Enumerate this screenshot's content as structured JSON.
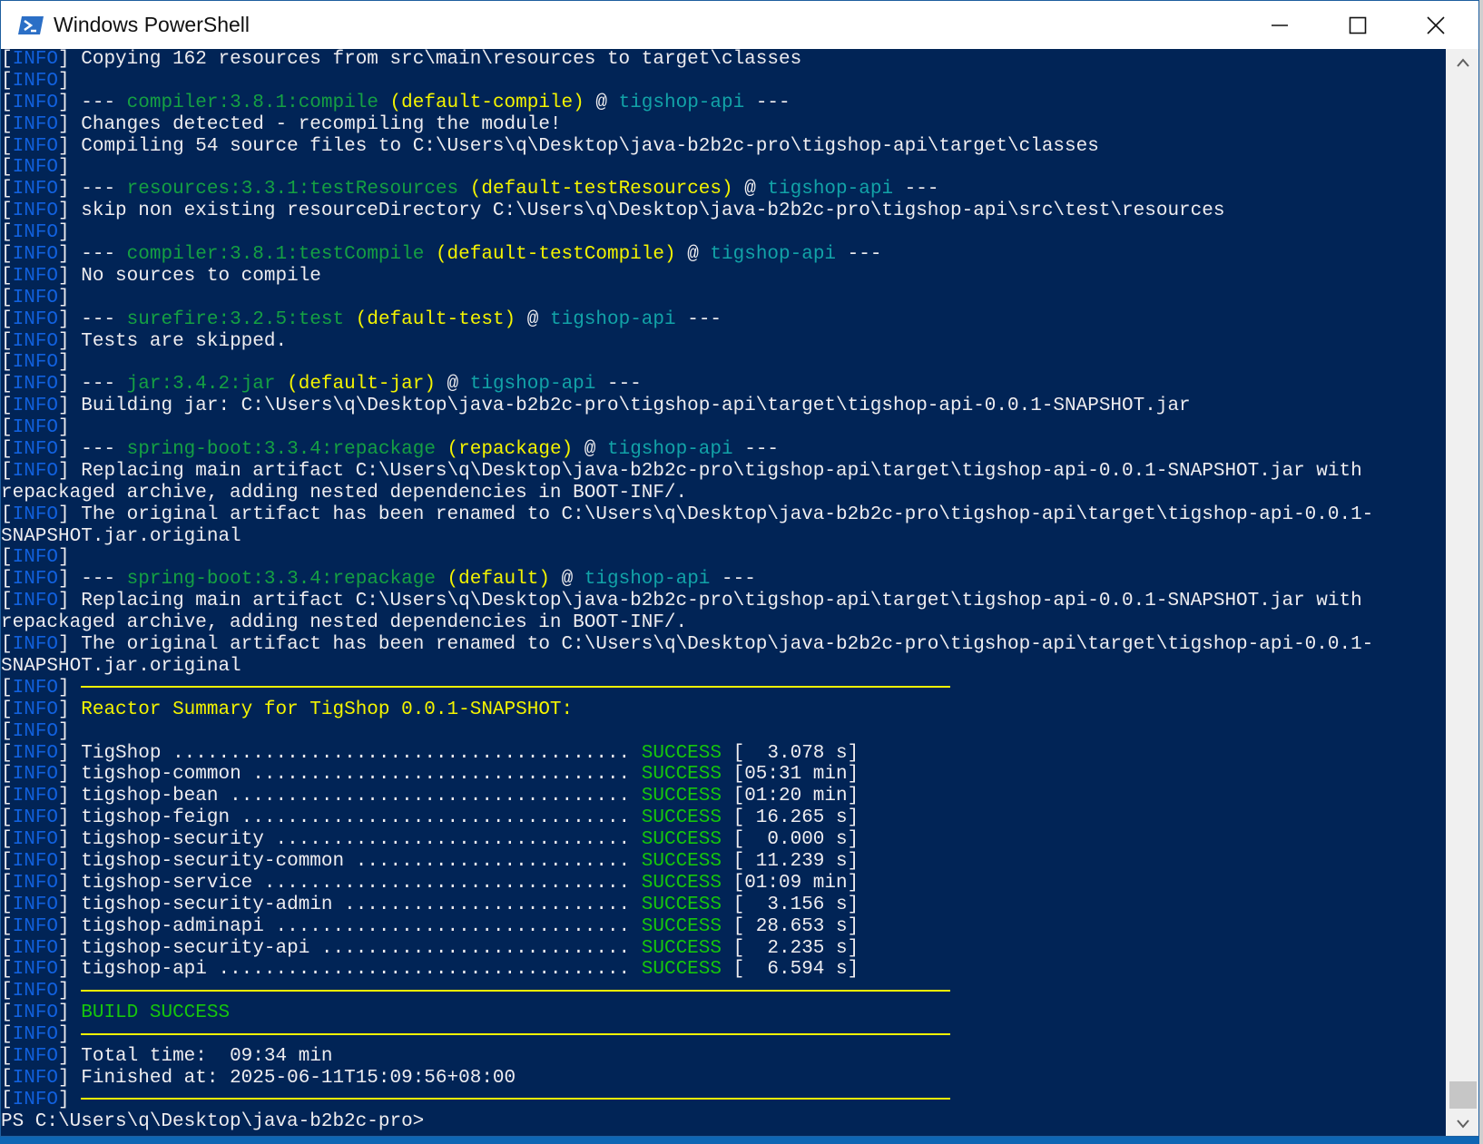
{
  "window": {
    "title": "Windows PowerShell",
    "icon": "powershell-icon",
    "controls": [
      "minimize-icon",
      "maximize-icon",
      "close-icon"
    ]
  },
  "colors": {
    "console_bg": "#012456",
    "info": "#1160dd",
    "plugin": "#15a043",
    "execution": "#f4f400",
    "project": "#12a3a8",
    "success": "#16c60c"
  },
  "lines": [
    {
      "type": "text",
      "text": "Copying 162 resources from src\\main\\resources to target\\classes"
    },
    {
      "type": "empty"
    },
    {
      "type": "mojo",
      "plugin": "compiler:3.8.1:compile",
      "exec": "(default-compile)",
      "project": "tigshop-api"
    },
    {
      "type": "text",
      "text": "Changes detected - recompiling the module!"
    },
    {
      "type": "text",
      "text": "Compiling 54 source files to C:\\Users\\q\\Desktop\\java-b2b2c-pro\\tigshop-api\\target\\classes"
    },
    {
      "type": "empty"
    },
    {
      "type": "mojo",
      "plugin": "resources:3.3.1:testResources",
      "exec": "(default-testResources)",
      "project": "tigshop-api"
    },
    {
      "type": "text",
      "text": "skip non existing resourceDirectory C:\\Users\\q\\Desktop\\java-b2b2c-pro\\tigshop-api\\src\\test\\resources"
    },
    {
      "type": "empty"
    },
    {
      "type": "mojo",
      "plugin": "compiler:3.8.1:testCompile",
      "exec": "(default-testCompile)",
      "project": "tigshop-api"
    },
    {
      "type": "text",
      "text": "No sources to compile"
    },
    {
      "type": "empty"
    },
    {
      "type": "mojo",
      "plugin": "surefire:3.2.5:test",
      "exec": "(default-test)",
      "project": "tigshop-api"
    },
    {
      "type": "text",
      "text": "Tests are skipped."
    },
    {
      "type": "empty"
    },
    {
      "type": "mojo",
      "plugin": "jar:3.4.2:jar",
      "exec": "(default-jar)",
      "project": "tigshop-api"
    },
    {
      "type": "text",
      "text": "Building jar: C:\\Users\\q\\Desktop\\java-b2b2c-pro\\tigshop-api\\target\\tigshop-api-0.0.1-SNAPSHOT.jar"
    },
    {
      "type": "empty"
    },
    {
      "type": "mojo",
      "plugin": "spring-boot:3.3.4:repackage",
      "exec": "(repackage)",
      "project": "tigshop-api"
    },
    {
      "type": "text",
      "text": "Replacing main artifact C:\\Users\\q\\Desktop\\java-b2b2c-pro\\tigshop-api\\target\\tigshop-api-0.0.1-SNAPSHOT.jar with"
    },
    {
      "type": "cont",
      "text": "repackaged archive, adding nested dependencies in BOOT-INF/."
    },
    {
      "type": "text",
      "text": "The original artifact has been renamed to C:\\Users\\q\\Desktop\\java-b2b2c-pro\\tigshop-api\\target\\tigshop-api-0.0.1-"
    },
    {
      "type": "cont",
      "text": "SNAPSHOT.jar.original"
    },
    {
      "type": "empty"
    },
    {
      "type": "mojo",
      "plugin": "spring-boot:3.3.4:repackage",
      "exec": "(default)",
      "project": "tigshop-api"
    },
    {
      "type": "text",
      "text": "Replacing main artifact C:\\Users\\q\\Desktop\\java-b2b2c-pro\\tigshop-api\\target\\tigshop-api-0.0.1-SNAPSHOT.jar with"
    },
    {
      "type": "cont",
      "text": "repackaged archive, adding nested dependencies in BOOT-INF/."
    },
    {
      "type": "text",
      "text": "The original artifact has been renamed to C:\\Users\\q\\Desktop\\java-b2b2c-pro\\tigshop-api\\target\\tigshop-api-0.0.1-"
    },
    {
      "type": "cont",
      "text": "SNAPSHOT.jar.original"
    },
    {
      "type": "rule"
    },
    {
      "type": "summary",
      "text": "Reactor Summary for TigShop 0.0.1-SNAPSHOT:"
    },
    {
      "type": "empty"
    },
    {
      "type": "module",
      "name": "TigShop",
      "dots": " ........................................ ",
      "status": "SUCCESS",
      "time": "[  3.078 s]"
    },
    {
      "type": "module",
      "name": "tigshop-common",
      "dots": " ................................. ",
      "status": "SUCCESS",
      "time": "[05:31 min]"
    },
    {
      "type": "module",
      "name": "tigshop-bean",
      "dots": " ................................... ",
      "status": "SUCCESS",
      "time": "[01:20 min]"
    },
    {
      "type": "module",
      "name": "tigshop-feign",
      "dots": " .................................. ",
      "status": "SUCCESS",
      "time": "[ 16.265 s]"
    },
    {
      "type": "module",
      "name": "tigshop-security",
      "dots": " ............................... ",
      "status": "SUCCESS",
      "time": "[  0.000 s]"
    },
    {
      "type": "module",
      "name": "tigshop-security-common",
      "dots": " ........................ ",
      "status": "SUCCESS",
      "time": "[ 11.239 s]"
    },
    {
      "type": "module",
      "name": "tigshop-service",
      "dots": " ................................ ",
      "status": "SUCCESS",
      "time": "[01:09 min]"
    },
    {
      "type": "module",
      "name": "tigshop-security-admin",
      "dots": " ......................... ",
      "status": "SUCCESS",
      "time": "[  3.156 s]"
    },
    {
      "type": "module",
      "name": "tigshop-adminapi",
      "dots": " ............................... ",
      "status": "SUCCESS",
      "time": "[ 28.653 s]"
    },
    {
      "type": "module",
      "name": "tigshop-security-api",
      "dots": " ........................... ",
      "status": "SUCCESS",
      "time": "[  2.235 s]"
    },
    {
      "type": "module",
      "name": "tigshop-api",
      "dots": " .................................... ",
      "status": "SUCCESS",
      "time": "[  6.594 s]"
    },
    {
      "type": "rule"
    },
    {
      "type": "build",
      "text": "BUILD SUCCESS"
    },
    {
      "type": "rule"
    },
    {
      "type": "text",
      "text": "Total time:  09:34 min"
    },
    {
      "type": "text",
      "text": "Finished at: 2025-06-11T15:09:56+08:00"
    },
    {
      "type": "rule"
    },
    {
      "type": "prompt",
      "text": "PS C:\\Users\\q\\Desktop\\java-b2b2c-pro>"
    }
  ],
  "labels": {
    "info": "INFO",
    "separator": "---",
    "at": "@"
  },
  "scrollbar": {
    "up_icon": "chevron-up-icon",
    "down_icon": "chevron-down-icon"
  }
}
